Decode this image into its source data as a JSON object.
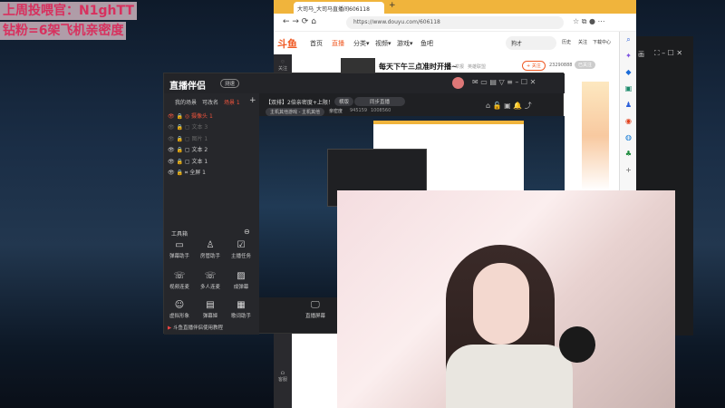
{
  "overlay": {
    "line1": "上周投喂官：N1ghTT",
    "line2": "钻粉=6架飞机亲密度"
  },
  "browser": {
    "tab_title": "大司马_大司马直播间606118",
    "url": "https://www.douyu.com/606118",
    "nav": [
      "首页",
      "直播",
      "分类▾",
      "视频▾",
      "游戏▾",
      "鱼吧"
    ],
    "search_value": "狗才",
    "header_icons": [
      "历史",
      "关注",
      "下载中心"
    ],
    "room_title": "每天下午三点准时开播~",
    "room_tag1": "举报",
    "room_tag2": "英雄联盟",
    "follow_label": "+ 关注",
    "follow_count": "23290888",
    "followed_label": "已关注",
    "left_items": [
      "关注",
      "客服"
    ],
    "edge_icons": [
      "search-icon",
      "sparkle-icon",
      "tag-icon",
      "briefcase-icon",
      "person-icon",
      "office-icon",
      "outlook-icon",
      "tree-icon",
      "plus-icon"
    ]
  },
  "app": {
    "name": "直播伴侣",
    "badge": "测速",
    "tabs": [
      "我的场景",
      "可改名",
      "场景 1"
    ],
    "scenes": [
      "摄像头 1",
      "文本 3",
      "图片 1",
      "文本 2",
      "文本 1",
      "全屏 1"
    ],
    "stream_title": "【双排】2倍亲密度+上限！",
    "mode_label": "横版",
    "input_placeholder": "同步直播",
    "category": "主机其他游戏 - 主机其他",
    "fans_label": "亲密度",
    "fans_value": "945159",
    "hot_value": "1008560",
    "toolbox_title": "工具箱",
    "tools": [
      "弹幕助手",
      "房管助手",
      "主播任务",
      "视频连麦",
      "多人连麦",
      "成弹幕",
      "虚拟形象",
      "弹幕姬",
      "歌词助手",
      "",
      "",
      ""
    ],
    "bottom_tip": "斗鱼直播伴侣使用教程",
    "screen_label": "直播屏幕"
  },
  "darkwin": {
    "title": "画"
  }
}
